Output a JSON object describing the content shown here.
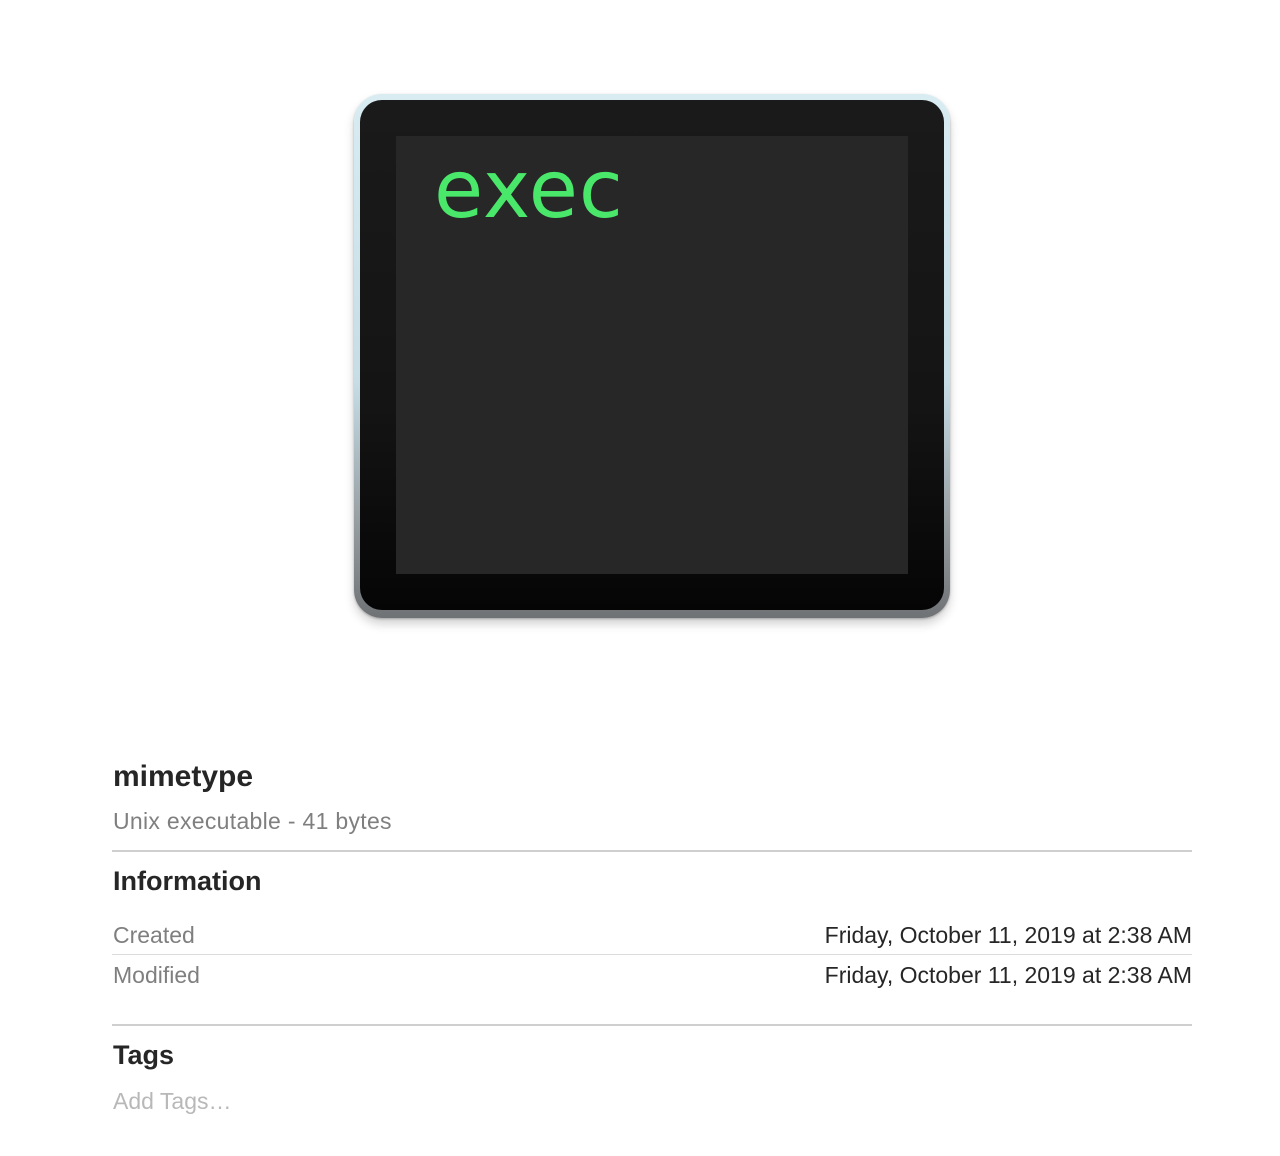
{
  "preview": {
    "icon": "terminal-exec-icon",
    "screen_text": "exec",
    "screen_text_color": "#4ae86a"
  },
  "file": {
    "name": "mimetype",
    "kind_size": "Unix executable - 41 bytes"
  },
  "information": {
    "title": "Information",
    "created_label": "Created",
    "created_value": "Friday, October 11, 2019 at 2:38 AM",
    "modified_label": "Modified",
    "modified_value": "Friday, October 11, 2019 at 2:38 AM"
  },
  "tags": {
    "title": "Tags",
    "placeholder": "Add Tags…"
  }
}
